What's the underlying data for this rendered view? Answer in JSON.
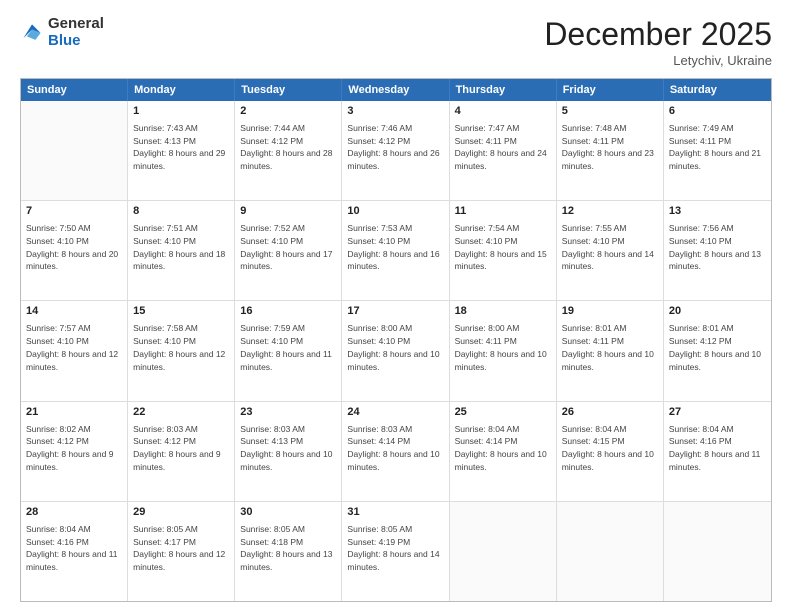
{
  "logo": {
    "general": "General",
    "blue": "Blue"
  },
  "title": "December 2025",
  "subtitle": "Letychiv, Ukraine",
  "header_days": [
    "Sunday",
    "Monday",
    "Tuesday",
    "Wednesday",
    "Thursday",
    "Friday",
    "Saturday"
  ],
  "weeks": [
    [
      {
        "day": "",
        "sunrise": "",
        "sunset": "",
        "daylight": ""
      },
      {
        "day": "1",
        "sunrise": "Sunrise: 7:43 AM",
        "sunset": "Sunset: 4:13 PM",
        "daylight": "Daylight: 8 hours and 29 minutes."
      },
      {
        "day": "2",
        "sunrise": "Sunrise: 7:44 AM",
        "sunset": "Sunset: 4:12 PM",
        "daylight": "Daylight: 8 hours and 28 minutes."
      },
      {
        "day": "3",
        "sunrise": "Sunrise: 7:46 AM",
        "sunset": "Sunset: 4:12 PM",
        "daylight": "Daylight: 8 hours and 26 minutes."
      },
      {
        "day": "4",
        "sunrise": "Sunrise: 7:47 AM",
        "sunset": "Sunset: 4:11 PM",
        "daylight": "Daylight: 8 hours and 24 minutes."
      },
      {
        "day": "5",
        "sunrise": "Sunrise: 7:48 AM",
        "sunset": "Sunset: 4:11 PM",
        "daylight": "Daylight: 8 hours and 23 minutes."
      },
      {
        "day": "6",
        "sunrise": "Sunrise: 7:49 AM",
        "sunset": "Sunset: 4:11 PM",
        "daylight": "Daylight: 8 hours and 21 minutes."
      }
    ],
    [
      {
        "day": "7",
        "sunrise": "Sunrise: 7:50 AM",
        "sunset": "Sunset: 4:10 PM",
        "daylight": "Daylight: 8 hours and 20 minutes."
      },
      {
        "day": "8",
        "sunrise": "Sunrise: 7:51 AM",
        "sunset": "Sunset: 4:10 PM",
        "daylight": "Daylight: 8 hours and 18 minutes."
      },
      {
        "day": "9",
        "sunrise": "Sunrise: 7:52 AM",
        "sunset": "Sunset: 4:10 PM",
        "daylight": "Daylight: 8 hours and 17 minutes."
      },
      {
        "day": "10",
        "sunrise": "Sunrise: 7:53 AM",
        "sunset": "Sunset: 4:10 PM",
        "daylight": "Daylight: 8 hours and 16 minutes."
      },
      {
        "day": "11",
        "sunrise": "Sunrise: 7:54 AM",
        "sunset": "Sunset: 4:10 PM",
        "daylight": "Daylight: 8 hours and 15 minutes."
      },
      {
        "day": "12",
        "sunrise": "Sunrise: 7:55 AM",
        "sunset": "Sunset: 4:10 PM",
        "daylight": "Daylight: 8 hours and 14 minutes."
      },
      {
        "day": "13",
        "sunrise": "Sunrise: 7:56 AM",
        "sunset": "Sunset: 4:10 PM",
        "daylight": "Daylight: 8 hours and 13 minutes."
      }
    ],
    [
      {
        "day": "14",
        "sunrise": "Sunrise: 7:57 AM",
        "sunset": "Sunset: 4:10 PM",
        "daylight": "Daylight: 8 hours and 12 minutes."
      },
      {
        "day": "15",
        "sunrise": "Sunrise: 7:58 AM",
        "sunset": "Sunset: 4:10 PM",
        "daylight": "Daylight: 8 hours and 12 minutes."
      },
      {
        "day": "16",
        "sunrise": "Sunrise: 7:59 AM",
        "sunset": "Sunset: 4:10 PM",
        "daylight": "Daylight: 8 hours and 11 minutes."
      },
      {
        "day": "17",
        "sunrise": "Sunrise: 8:00 AM",
        "sunset": "Sunset: 4:10 PM",
        "daylight": "Daylight: 8 hours and 10 minutes."
      },
      {
        "day": "18",
        "sunrise": "Sunrise: 8:00 AM",
        "sunset": "Sunset: 4:11 PM",
        "daylight": "Daylight: 8 hours and 10 minutes."
      },
      {
        "day": "19",
        "sunrise": "Sunrise: 8:01 AM",
        "sunset": "Sunset: 4:11 PM",
        "daylight": "Daylight: 8 hours and 10 minutes."
      },
      {
        "day": "20",
        "sunrise": "Sunrise: 8:01 AM",
        "sunset": "Sunset: 4:12 PM",
        "daylight": "Daylight: 8 hours and 10 minutes."
      }
    ],
    [
      {
        "day": "21",
        "sunrise": "Sunrise: 8:02 AM",
        "sunset": "Sunset: 4:12 PM",
        "daylight": "Daylight: 8 hours and 9 minutes."
      },
      {
        "day": "22",
        "sunrise": "Sunrise: 8:03 AM",
        "sunset": "Sunset: 4:12 PM",
        "daylight": "Daylight: 8 hours and 9 minutes."
      },
      {
        "day": "23",
        "sunrise": "Sunrise: 8:03 AM",
        "sunset": "Sunset: 4:13 PM",
        "daylight": "Daylight: 8 hours and 10 minutes."
      },
      {
        "day": "24",
        "sunrise": "Sunrise: 8:03 AM",
        "sunset": "Sunset: 4:14 PM",
        "daylight": "Daylight: 8 hours and 10 minutes."
      },
      {
        "day": "25",
        "sunrise": "Sunrise: 8:04 AM",
        "sunset": "Sunset: 4:14 PM",
        "daylight": "Daylight: 8 hours and 10 minutes."
      },
      {
        "day": "26",
        "sunrise": "Sunrise: 8:04 AM",
        "sunset": "Sunset: 4:15 PM",
        "daylight": "Daylight: 8 hours and 10 minutes."
      },
      {
        "day": "27",
        "sunrise": "Sunrise: 8:04 AM",
        "sunset": "Sunset: 4:16 PM",
        "daylight": "Daylight: 8 hours and 11 minutes."
      }
    ],
    [
      {
        "day": "28",
        "sunrise": "Sunrise: 8:04 AM",
        "sunset": "Sunset: 4:16 PM",
        "daylight": "Daylight: 8 hours and 11 minutes."
      },
      {
        "day": "29",
        "sunrise": "Sunrise: 8:05 AM",
        "sunset": "Sunset: 4:17 PM",
        "daylight": "Daylight: 8 hours and 12 minutes."
      },
      {
        "day": "30",
        "sunrise": "Sunrise: 8:05 AM",
        "sunset": "Sunset: 4:18 PM",
        "daylight": "Daylight: 8 hours and 13 minutes."
      },
      {
        "day": "31",
        "sunrise": "Sunrise: 8:05 AM",
        "sunset": "Sunset: 4:19 PM",
        "daylight": "Daylight: 8 hours and 14 minutes."
      },
      {
        "day": "",
        "sunrise": "",
        "sunset": "",
        "daylight": ""
      },
      {
        "day": "",
        "sunrise": "",
        "sunset": "",
        "daylight": ""
      },
      {
        "day": "",
        "sunrise": "",
        "sunset": "",
        "daylight": ""
      }
    ]
  ]
}
